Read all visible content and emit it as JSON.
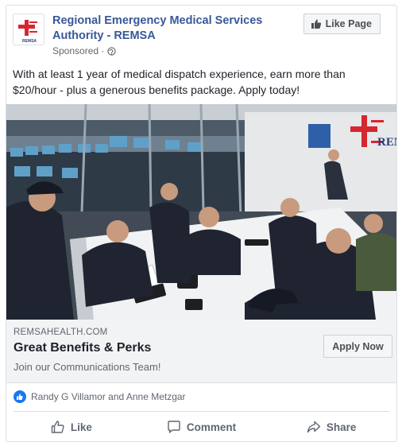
{
  "post": {
    "page_name": "Regional Emergency Medical Services Authority - REMSA",
    "sponsored_label": "Sponsored ·",
    "like_page_label": "Like Page",
    "logo_text": "REMSA",
    "body_text": "With at least 1 year of medical dispatch experience, earn more than $20/hour - plus a generous benefits package. Apply today!"
  },
  "photo": {
    "wall_sign_text": "REM"
  },
  "link": {
    "domain": "REMSAHEALTH.COM",
    "headline": "Great Benefits & Perks",
    "description": "Join our Communications Team!",
    "cta_label": "Apply Now"
  },
  "reactions": {
    "names": "Randy G Villamor and Anne Metzgar"
  },
  "actions": {
    "like_label": "Like",
    "comment_label": "Comment",
    "share_label": "Share"
  },
  "colors": {
    "link_blue": "#385898",
    "facebook_blue": "#1877f2",
    "remsa_red": "#d7262e"
  }
}
